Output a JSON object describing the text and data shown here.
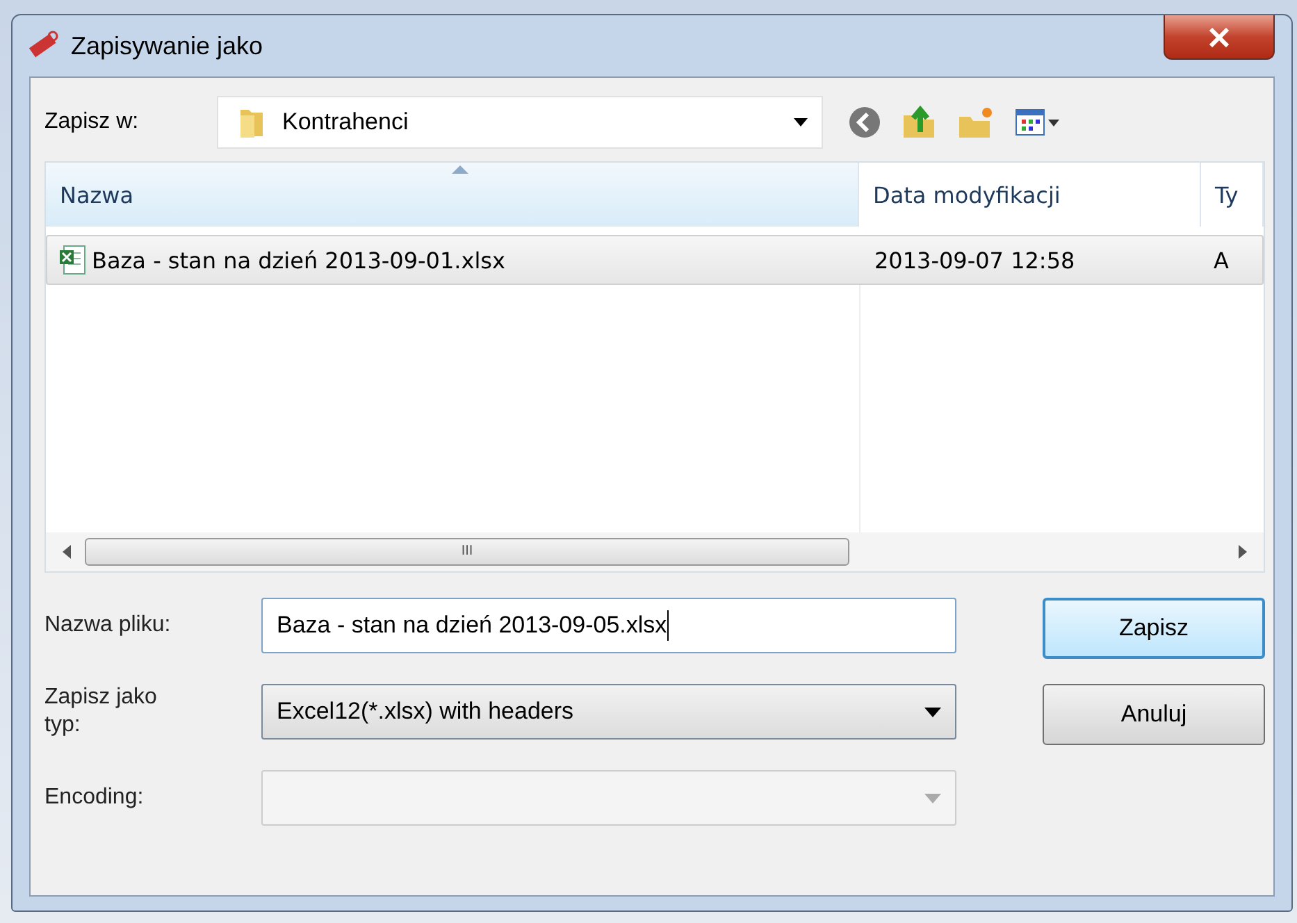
{
  "window": {
    "title": "Zapisywanie jako"
  },
  "location": {
    "label": "Zapisz w:",
    "value": "Kontrahenci"
  },
  "file_list": {
    "columns": [
      {
        "label": "Nazwa",
        "sorted": true
      },
      {
        "label": "Data modyfikacji",
        "sorted": false
      },
      {
        "label": "Ty",
        "sorted": false
      }
    ],
    "rows": [
      {
        "cells": [
          "Baza - stan na dzień 2013-09-01.xlsx",
          "2013-09-07 12:58",
          "A"
        ],
        "selected": true
      }
    ],
    "scrollbar_symbol": "III"
  },
  "fields": [
    {
      "kind": "text",
      "label": "Nazwa pliku:",
      "value": "Baza - stan na dzień 2013-09-05.xlsx",
      "disabled": false
    },
    {
      "kind": "combo",
      "label": "Zapisz jako typ:",
      "value": "Excel12(*.xlsx) with headers",
      "disabled": false
    },
    {
      "kind": "combo",
      "label": "Encoding:",
      "disabled": true
    }
  ],
  "buttons": [
    {
      "label": "Zapisz",
      "default": true
    },
    {
      "label": "Anuluj",
      "default": false
    }
  ]
}
